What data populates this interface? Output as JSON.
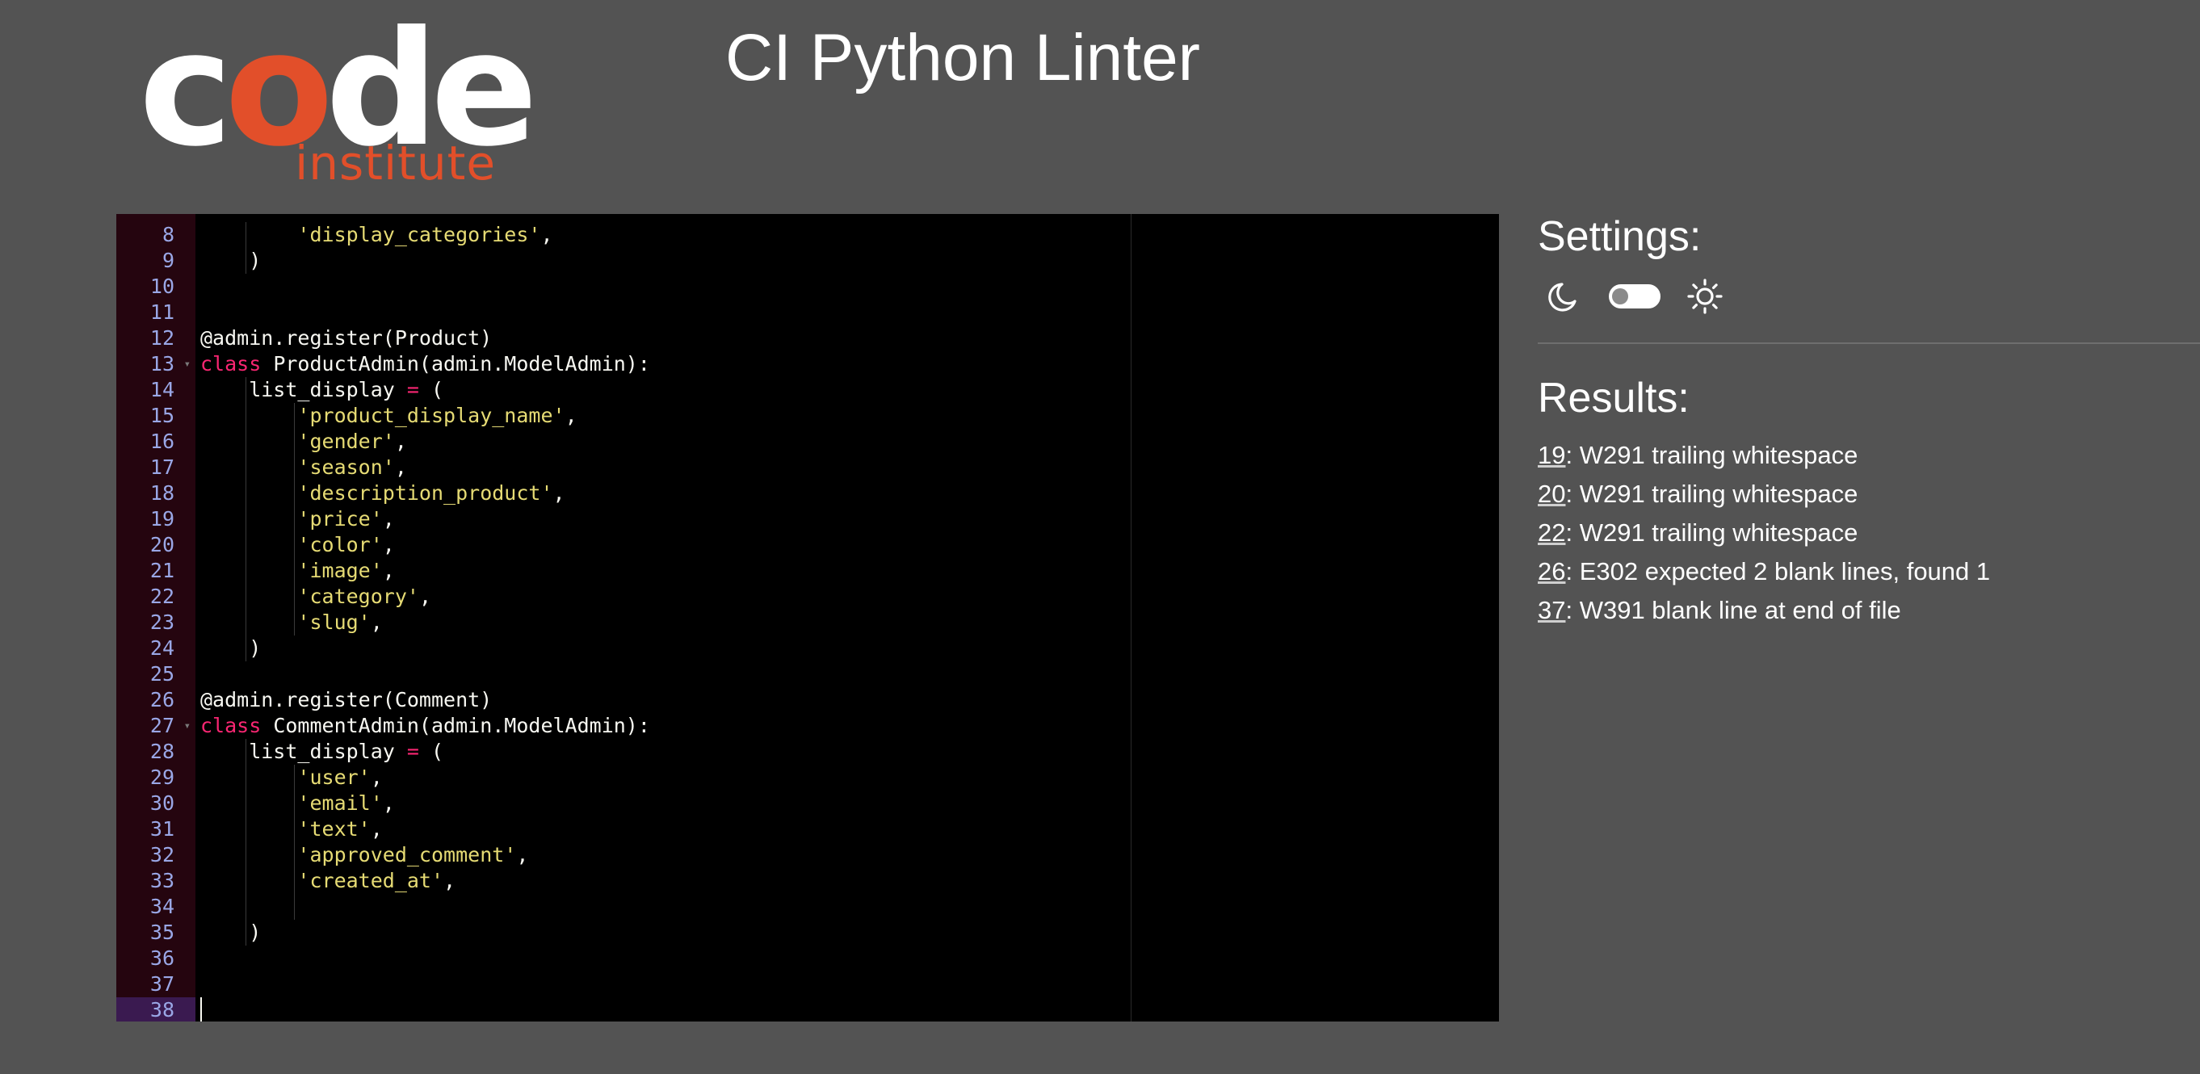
{
  "logo": {
    "word_start": "c",
    "word_o": "o",
    "word_end": "de",
    "sub": "institute"
  },
  "header": {
    "title": "CI Python Linter"
  },
  "colors": {
    "background": "#535353",
    "brand_orange": "#e24f2a",
    "editor_bg": "#000000",
    "gutter_bg": "#25050f"
  },
  "editor": {
    "lines": [
      {
        "n": "8",
        "fold": "",
        "tokens": [
          [
            "t",
            "        "
          ],
          [
            "str",
            "'display_categories'"
          ],
          [
            "t",
            ","
          ]
        ]
      },
      {
        "n": "9",
        "fold": "",
        "tokens": [
          [
            "t",
            "    )"
          ]
        ]
      },
      {
        "n": "10",
        "fold": "",
        "tokens": []
      },
      {
        "n": "11",
        "fold": "",
        "tokens": []
      },
      {
        "n": "12",
        "fold": "",
        "tokens": [
          [
            "t",
            "@admin.register(Product)"
          ]
        ]
      },
      {
        "n": "13",
        "fold": "▾",
        "tokens": [
          [
            "kw",
            "class"
          ],
          [
            "t",
            " ProductAdmin(admin.ModelAdmin):"
          ]
        ]
      },
      {
        "n": "14",
        "fold": "",
        "tokens": [
          [
            "t",
            "    list_display "
          ],
          [
            "op",
            "="
          ],
          [
            "t",
            " ("
          ]
        ]
      },
      {
        "n": "15",
        "fold": "",
        "tokens": [
          [
            "t",
            "        "
          ],
          [
            "str",
            "'product_display_name'"
          ],
          [
            "t",
            ","
          ]
        ]
      },
      {
        "n": "16",
        "fold": "",
        "tokens": [
          [
            "t",
            "        "
          ],
          [
            "str",
            "'gender'"
          ],
          [
            "t",
            ","
          ]
        ]
      },
      {
        "n": "17",
        "fold": "",
        "tokens": [
          [
            "t",
            "        "
          ],
          [
            "str",
            "'season'"
          ],
          [
            "t",
            ","
          ]
        ]
      },
      {
        "n": "18",
        "fold": "",
        "tokens": [
          [
            "t",
            "        "
          ],
          [
            "str",
            "'description_product'"
          ],
          [
            "t",
            ","
          ]
        ]
      },
      {
        "n": "19",
        "fold": "",
        "tokens": [
          [
            "t",
            "        "
          ],
          [
            "str",
            "'price'"
          ],
          [
            "t",
            ","
          ]
        ]
      },
      {
        "n": "20",
        "fold": "",
        "tokens": [
          [
            "t",
            "        "
          ],
          [
            "str",
            "'color'"
          ],
          [
            "t",
            ","
          ]
        ]
      },
      {
        "n": "21",
        "fold": "",
        "tokens": [
          [
            "t",
            "        "
          ],
          [
            "str",
            "'image'"
          ],
          [
            "t",
            ","
          ]
        ]
      },
      {
        "n": "22",
        "fold": "",
        "tokens": [
          [
            "t",
            "        "
          ],
          [
            "str",
            "'category'"
          ],
          [
            "t",
            ","
          ]
        ]
      },
      {
        "n": "23",
        "fold": "",
        "tokens": [
          [
            "t",
            "        "
          ],
          [
            "str",
            "'slug'"
          ],
          [
            "t",
            ","
          ]
        ]
      },
      {
        "n": "24",
        "fold": "",
        "tokens": [
          [
            "t",
            "    )"
          ]
        ]
      },
      {
        "n": "25",
        "fold": "",
        "tokens": []
      },
      {
        "n": "26",
        "fold": "",
        "tokens": [
          [
            "t",
            "@admin.register(Comment)"
          ]
        ]
      },
      {
        "n": "27",
        "fold": "▾",
        "tokens": [
          [
            "kw",
            "class"
          ],
          [
            "t",
            " CommentAdmin(admin.ModelAdmin):"
          ]
        ]
      },
      {
        "n": "28",
        "fold": "",
        "tokens": [
          [
            "t",
            "    list_display "
          ],
          [
            "op",
            "="
          ],
          [
            "t",
            " ("
          ]
        ]
      },
      {
        "n": "29",
        "fold": "",
        "tokens": [
          [
            "t",
            "        "
          ],
          [
            "str",
            "'user'"
          ],
          [
            "t",
            ","
          ]
        ]
      },
      {
        "n": "30",
        "fold": "",
        "tokens": [
          [
            "t",
            "        "
          ],
          [
            "str",
            "'email'"
          ],
          [
            "t",
            ","
          ]
        ]
      },
      {
        "n": "31",
        "fold": "",
        "tokens": [
          [
            "t",
            "        "
          ],
          [
            "str",
            "'text'"
          ],
          [
            "t",
            ","
          ]
        ]
      },
      {
        "n": "32",
        "fold": "",
        "tokens": [
          [
            "t",
            "        "
          ],
          [
            "str",
            "'approved_comment'"
          ],
          [
            "t",
            ","
          ]
        ]
      },
      {
        "n": "33",
        "fold": "",
        "tokens": [
          [
            "t",
            "        "
          ],
          [
            "str",
            "'created_at'"
          ],
          [
            "t",
            ","
          ]
        ]
      },
      {
        "n": "34",
        "fold": "",
        "tokens": []
      },
      {
        "n": "35",
        "fold": "",
        "tokens": [
          [
            "t",
            "    )"
          ]
        ]
      },
      {
        "n": "36",
        "fold": "",
        "tokens": []
      },
      {
        "n": "37",
        "fold": "",
        "tokens": []
      },
      {
        "n": "38",
        "fold": "",
        "tokens": []
      }
    ],
    "active_line": "38"
  },
  "settings": {
    "title": "Settings:",
    "theme_toggle": {
      "left_icon": "moon-icon",
      "right_icon": "sun-icon",
      "dark_mode_on": false
    }
  },
  "results": {
    "title": "Results:",
    "items": [
      {
        "line": "19",
        "message": ": W291 trailing whitespace"
      },
      {
        "line": "20",
        "message": ": W291 trailing whitespace"
      },
      {
        "line": "22",
        "message": ": W291 trailing whitespace"
      },
      {
        "line": "26",
        "message": ": E302 expected 2 blank lines, found 1"
      },
      {
        "line": "37",
        "message": ": W391 blank line at end of file"
      }
    ]
  }
}
